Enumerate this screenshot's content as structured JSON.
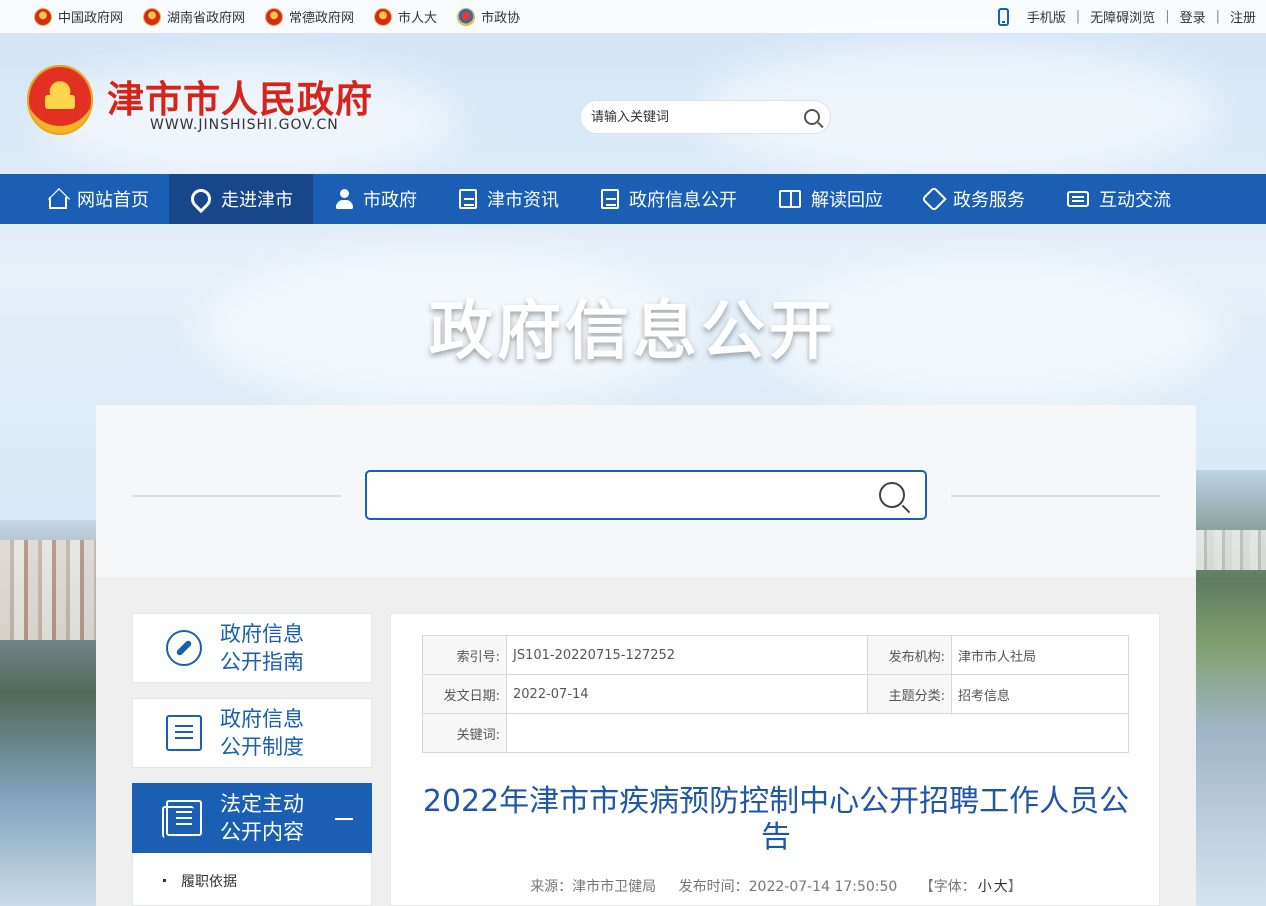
{
  "topbar": {
    "links": [
      "中国政府网",
      "湖南省政府网",
      "常德政府网",
      "市人大",
      "市政协"
    ],
    "right": {
      "mobile": "手机版",
      "accessible": "无障碍浏览",
      "login": "登录",
      "register": "注册"
    }
  },
  "header": {
    "title": "津市市人民政府",
    "domain": "WWW.JINSHISHI.GOV.CN",
    "search_placeholder": "请输入关键词"
  },
  "nav": {
    "items": [
      "网站首页",
      "走进津市",
      "市政府",
      "津市资讯",
      "政府信息公开",
      "解读回应",
      "政务服务",
      "互动交流"
    ],
    "active_index": 1
  },
  "banner": {
    "title": "政府信息公开"
  },
  "colors": {
    "brand_blue": "#1a5fb4",
    "title_red": "#d8231b",
    "nav_active": "#17478a"
  },
  "sidebar": {
    "cards": [
      {
        "label": "政府信息\n公开指南",
        "icon": "compass-icon"
      },
      {
        "label": "政府信息\n公开制度",
        "icon": "list-icon"
      },
      {
        "label": "法定主动\n公开内容",
        "icon": "stack-icon",
        "active": true
      }
    ],
    "sub_item": "履职依据"
  },
  "article": {
    "meta": {
      "index_label": "索引号:",
      "index_value": "JS101-20220715-127252",
      "org_label": "发布机构:",
      "org_value": "津市市人社局",
      "date_label": "发文日期:",
      "date_value": "2022-07-14",
      "topic_label": "主题分类:",
      "topic_value": "招考信息",
      "keyword_label": "关键词:",
      "keyword_value": ""
    },
    "title": "2022年津市市疾病预防控制中心公开招聘工作人员公告",
    "source": "来源：津市市卫健局",
    "publish_time": "发布时间：2022-07-14 17:50:50",
    "font_label": "【字体：",
    "font_small": "小",
    "font_large": "大",
    "font_close": "】"
  }
}
